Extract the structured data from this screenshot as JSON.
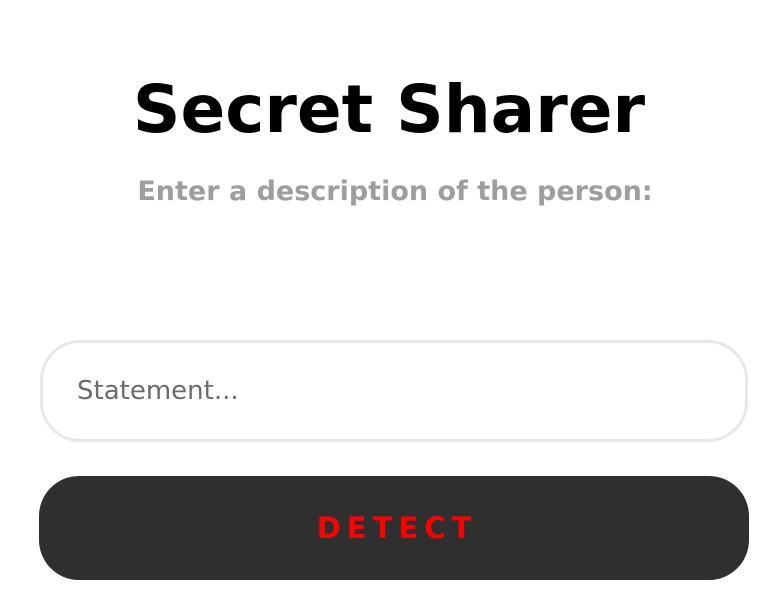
{
  "header": {
    "title": "Secret Sharer",
    "subtitle": "Enter a description of the person:"
  },
  "form": {
    "statement_placeholder": "Statement...",
    "statement_value": "",
    "detect_label": "DETECT"
  },
  "colors": {
    "title": "#000000",
    "subtitle": "#9e9e9e",
    "input_border": "#e8e8e8",
    "button_background": "#2f2f2f",
    "button_text": "#ff0000"
  }
}
